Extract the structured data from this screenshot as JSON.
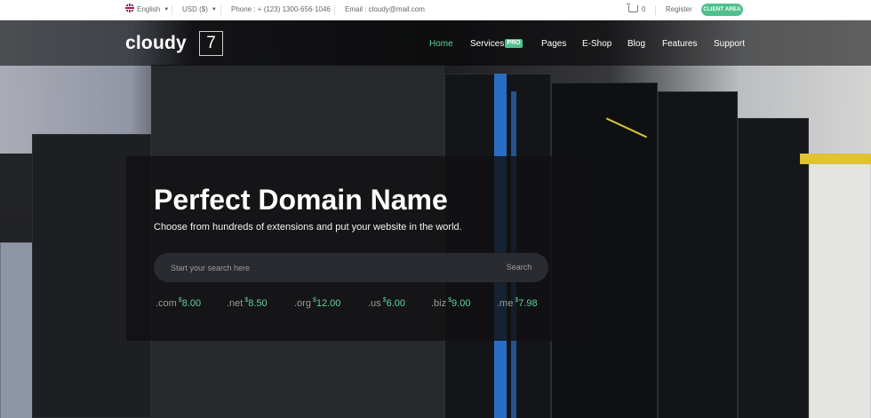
{
  "topbar": {
    "language": "English",
    "currency": "USD ($)",
    "phone": "Phone : + (123) 1300-656-1046",
    "email": "Email : cloudy@mail.com",
    "cart_count": "0",
    "register": "Register",
    "client_area": "CLIENT AREA"
  },
  "brand": {
    "name": "cloudy",
    "badge": "7"
  },
  "nav": {
    "items": [
      "Home",
      "Services",
      "Pages",
      "E-Shop",
      "Blog",
      "Features",
      "Support"
    ],
    "services_badge": "PRO",
    "active_color": "#5fd39b"
  },
  "hero": {
    "title": "Perfect Domain Name",
    "subtitle": "Choose from hundreds of extensions and put your website in the world.",
    "search_placeholder": "Start your search here",
    "search_button": "Search",
    "tlds": [
      {
        "ext": ".com",
        "currency": "$",
        "amount": "8.00"
      },
      {
        "ext": ".net",
        "currency": "$",
        "amount": "8.50"
      },
      {
        "ext": ".org",
        "currency": "$",
        "amount": "12.00"
      },
      {
        "ext": ".us",
        "currency": "$",
        "amount": "6.00"
      },
      {
        "ext": ".biz",
        "currency": "$",
        "amount": "9.00"
      },
      {
        "ext": ".me",
        "currency": "$",
        "amount": "7.98"
      }
    ]
  },
  "colors": {
    "accent": "#4fc08d",
    "panel": "#111112"
  }
}
